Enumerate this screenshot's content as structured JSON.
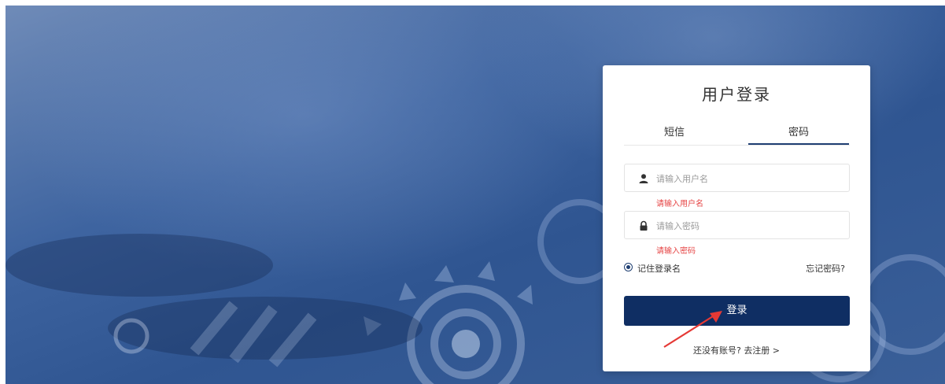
{
  "login": {
    "title": "用户登录",
    "tabs": [
      {
        "label": "短信",
        "active": false
      },
      {
        "label": "密码",
        "active": true
      }
    ],
    "username": {
      "placeholder": "请输入用户名",
      "value": "",
      "error": "请输入用户名"
    },
    "password": {
      "placeholder": "请输入密码",
      "value": "",
      "error": "请输入密码"
    },
    "remember_label": "记住登录名",
    "forgot_label": "忘记密码?",
    "login_button": "登录",
    "register_prompt": "还没有账号?",
    "register_link": "去注册 >"
  },
  "colors": {
    "primary": "#0f2e63",
    "error": "#e64545",
    "annotation_arrow": "#e53935"
  },
  "icons": {
    "username": "user-icon",
    "password": "lock-icon"
  }
}
